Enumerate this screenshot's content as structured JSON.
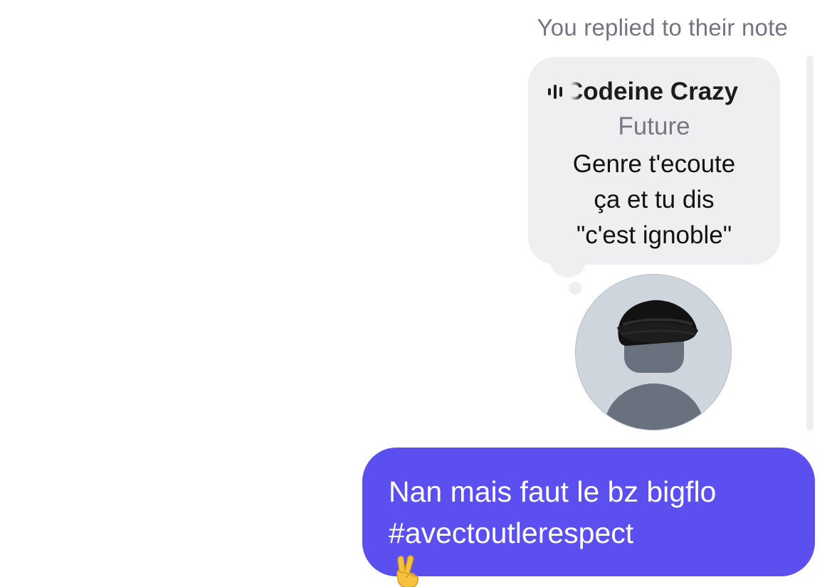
{
  "thread": {
    "reply_caption": "You replied to their note"
  },
  "note": {
    "icon": "audio-bars-icon",
    "song_title": "Codeine Crazy",
    "artist": "Future",
    "text_lines": [
      "Genre t'ecoute",
      "ça et tu dis",
      "\"c'est ignoble\""
    ],
    "bubble_color": "#efeff2"
  },
  "avatar": {
    "icon": "default-person-avatar-icon"
  },
  "message": {
    "lines": [
      "Nan mais faut le bz bigflo",
      "#avectoutlerespect"
    ],
    "emoji": "victory-hand-icon",
    "bubble_color": "#5b4ff0",
    "text_color": "#ffffff"
  }
}
